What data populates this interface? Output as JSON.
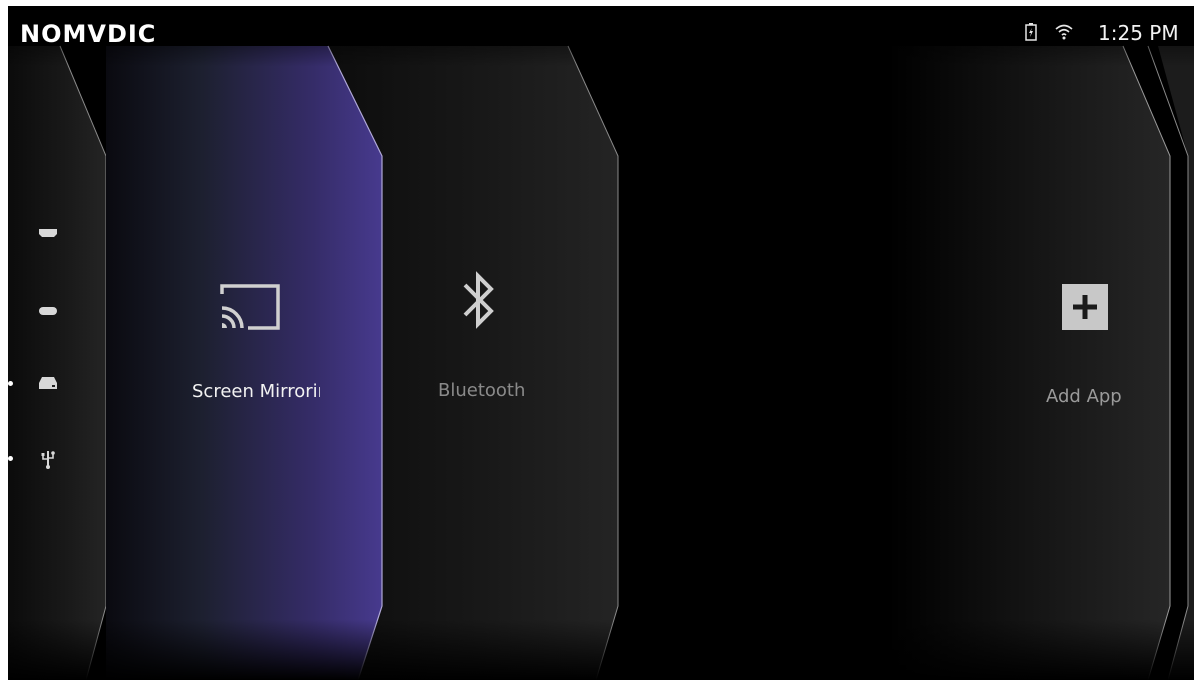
{
  "header": {
    "logo": "NOMVDIC",
    "time": "1:25 PM",
    "status_icons": [
      "battery-charging-icon",
      "wifi-icon"
    ]
  },
  "sidebar": {
    "source_icons": [
      "hdmi-icon",
      "usb-c-icon",
      "storage-drive-icon",
      "usb-icon"
    ],
    "selected_indicators": [
      "storage-drive-icon",
      "usb-icon"
    ]
  },
  "tiles": [
    {
      "id": "screen-mirror",
      "label": "Screen Mirroring",
      "icon": "cast-icon",
      "focused": true
    },
    {
      "id": "bluetooth",
      "label": "Bluetooth",
      "icon": "bluetooth-icon",
      "focused": false
    },
    {
      "id": "add-app",
      "label": "Add App",
      "icon": "plus-icon",
      "focused": false
    }
  ],
  "colors": {
    "background": "#000000",
    "focus_accent": "#4a3a8c",
    "tile_fill": "#1a1a1a"
  }
}
